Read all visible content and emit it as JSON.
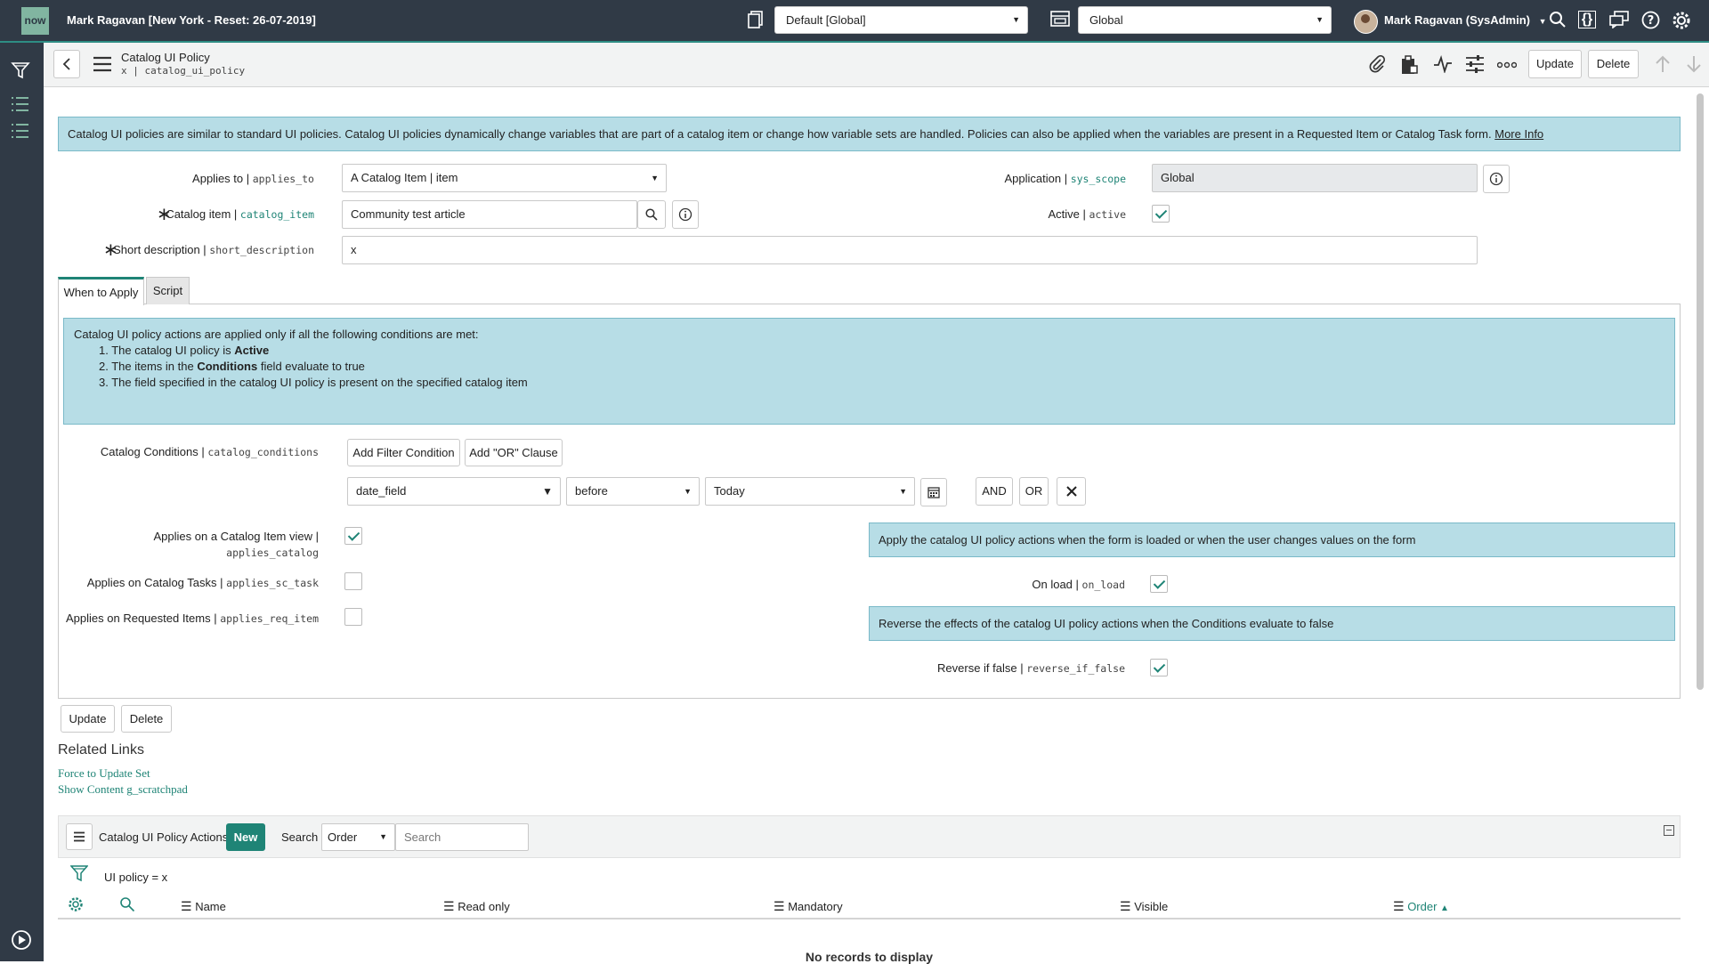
{
  "topbar": {
    "logo": "now",
    "user_context": "Mark Ragavan [New York - Reset: 26-07-2019]",
    "update_set": "Default [Global]",
    "application_scope": "Global",
    "user_name": "Mark Ragavan (SysAdmin)",
    "icons": [
      "update-set-icon",
      "application-icon",
      "search-icon",
      "script-debugger-icon",
      "chat-icon",
      "help-icon",
      "settings-icon"
    ]
  },
  "header": {
    "title": "Catalog UI Policy",
    "table": "x | catalog_ui_policy",
    "update_label": "Update",
    "delete_label": "Delete"
  },
  "intro": {
    "text": "Catalog UI policies are similar to standard UI policies. Catalog UI policies dynamically change variables that are part of a catalog item or change how variable sets are handled. Policies can also be applied when the variables are present in a Requested Item or Catalog Task form.",
    "more_info": "More Info"
  },
  "form": {
    "applies_to": {
      "label": "Applies to",
      "field": "applies_to",
      "value": "A Catalog Item | item"
    },
    "catalog_item": {
      "label": "Catalog item",
      "field": "catalog_item",
      "value": "Community test article"
    },
    "short_description": {
      "label": "Short description",
      "field": "short_description",
      "value": "x"
    },
    "application": {
      "label": "Application",
      "field": "sys_scope",
      "value": "Global"
    },
    "active": {
      "label": "Active",
      "field": "active",
      "checked": true
    }
  },
  "tabs": [
    {
      "label": "When to Apply",
      "active": true
    },
    {
      "label": "Script",
      "active": false
    }
  ],
  "conditions_info": {
    "intro": "Catalog UI policy actions are applied only if all the following conditions are met:",
    "items": [
      {
        "pre": "The catalog UI policy is ",
        "bold": "Active",
        "post": ""
      },
      {
        "pre": "The items in the ",
        "bold": "Conditions",
        "post": " field evaluate to true"
      },
      {
        "pre": "The field specified in the catalog UI policy is present on the specified catalog item",
        "bold": "",
        "post": ""
      }
    ]
  },
  "catalog_conditions": {
    "label": "Catalog Conditions",
    "field": "catalog_conditions",
    "add_filter": "Add Filter Condition",
    "add_or": "Add \"OR\" Clause",
    "condition": {
      "field": "date_field",
      "operator": "before",
      "value": "Today"
    },
    "and_label": "AND",
    "or_label": "OR"
  },
  "applies": {
    "catalog_view": {
      "label": "Applies on a Catalog Item view |",
      "field": "applies_catalog",
      "checked": true
    },
    "sc_task": {
      "label": "Applies on Catalog Tasks",
      "field": "applies_sc_task",
      "checked": false
    },
    "req_item": {
      "label": "Applies on Requested Items",
      "field": "applies_req_item",
      "checked": false
    }
  },
  "onload_info": "Apply the catalog UI policy actions when the form is loaded or when the user changes values on the form",
  "on_load": {
    "label": "On load",
    "field": "on_load",
    "checked": true
  },
  "reverse_info": "Reverse the effects of the catalog UI policy actions when the Conditions evaluate to false",
  "reverse_if_false": {
    "label": "Reverse if false",
    "field": "reverse_if_false",
    "checked": true
  },
  "bottom_buttons": {
    "update": "Update",
    "delete": "Delete"
  },
  "related_links": {
    "title": "Related Links",
    "links": [
      "Force to Update Set",
      "Show Content g_scratchpad"
    ]
  },
  "related_list": {
    "title": "Catalog UI Policy Actions",
    "new_label": "New",
    "search_label": "Search",
    "search_field": "Order",
    "search_placeholder": "Search",
    "filter": "UI policy = x",
    "columns": [
      "Name",
      "Read only",
      "Mandatory",
      "Visible",
      "Order"
    ],
    "sort_column": "Order",
    "empty_text": "No records to display"
  },
  "colors": {
    "accent": "#1f8476",
    "banner": "#303a46",
    "info": "#b7dde6"
  }
}
